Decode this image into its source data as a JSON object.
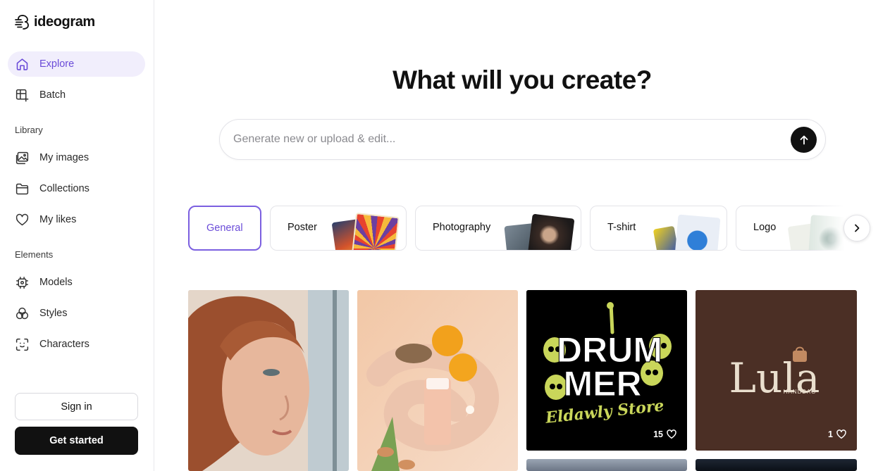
{
  "brand": {
    "name": "ideogram"
  },
  "sidebar": {
    "nav": [
      {
        "label": "Explore",
        "icon": "home-icon",
        "active": true
      },
      {
        "label": "Batch",
        "icon": "batch-icon",
        "active": false
      }
    ],
    "library": {
      "heading": "Library",
      "items": [
        {
          "label": "My images",
          "icon": "images-icon"
        },
        {
          "label": "Collections",
          "icon": "folder-icon"
        },
        {
          "label": "My likes",
          "icon": "heart-icon"
        }
      ]
    },
    "elements": {
      "heading": "Elements",
      "items": [
        {
          "label": "Models",
          "icon": "chip-icon"
        },
        {
          "label": "Styles",
          "icon": "styles-icon"
        },
        {
          "label": "Characters",
          "icon": "face-scan-icon"
        }
      ]
    },
    "sign_in_label": "Sign in",
    "get_started_label": "Get started"
  },
  "main": {
    "headline": "What will you create?",
    "prompt": {
      "placeholder": "Generate new or upload & edit..."
    },
    "categories": [
      {
        "label": "General",
        "selected": true
      },
      {
        "label": "Poster",
        "selected": false
      },
      {
        "label": "Photography",
        "selected": false
      },
      {
        "label": "T-shirt",
        "selected": false
      },
      {
        "label": "Logo",
        "selected": false
      }
    ],
    "gallery": [
      {
        "description": "portrait of a red-haired woman by a window",
        "likes": ""
      },
      {
        "description": "skincare product bottle with orange and creamy swirl",
        "likes": ""
      },
      {
        "description": "DRUMMER Eldawly Store t-shirt design with skulls",
        "likes": "15",
        "text": [
          "DRUM",
          "MER",
          "Eldawly Store"
        ]
      },
      {
        "description": "Lula handbag logo",
        "likes": "1",
        "text": [
          "Lula",
          "HANDBAG"
        ]
      }
    ]
  },
  "colors": {
    "accent": "#6a4bd8",
    "active_bg": "#f1eefc",
    "dark": "#111111"
  }
}
